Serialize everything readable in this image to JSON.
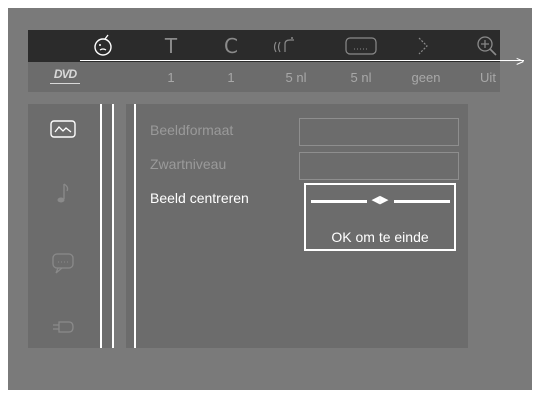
{
  "topbar": {
    "icons": [
      {
        "name": "smiley-icon",
        "glyph": "☺"
      },
      {
        "name": "title-icon",
        "glyph": "T"
      },
      {
        "name": "chapter-icon",
        "glyph": "C"
      },
      {
        "name": "audio-icon",
        "glyph": "((☊"
      },
      {
        "name": "subtitle-icon",
        "glyph": "…"
      },
      {
        "name": "angle-icon",
        "glyph": "⟩"
      },
      {
        "name": "zoom-icon",
        "glyph": "⊕"
      }
    ],
    "values": [
      "1",
      "1",
      "5 nl",
      "5 nl",
      "geen",
      "Uit"
    ],
    "disc_logo": "DVD"
  },
  "settings": {
    "items": [
      {
        "label": "Beeldformaat"
      },
      {
        "label": "Zwartniveau"
      },
      {
        "label": "Beeld centreren"
      }
    ]
  },
  "popup": {
    "slider_arrows": "◀▶",
    "instruction": "OK om te einde"
  },
  "colors": {
    "background": "#7a7a7a",
    "topbar": "#2b2b2b",
    "panel": "#6c6c6c",
    "active_text": "#ffffff",
    "inactive_text": "#9a9a9a"
  }
}
